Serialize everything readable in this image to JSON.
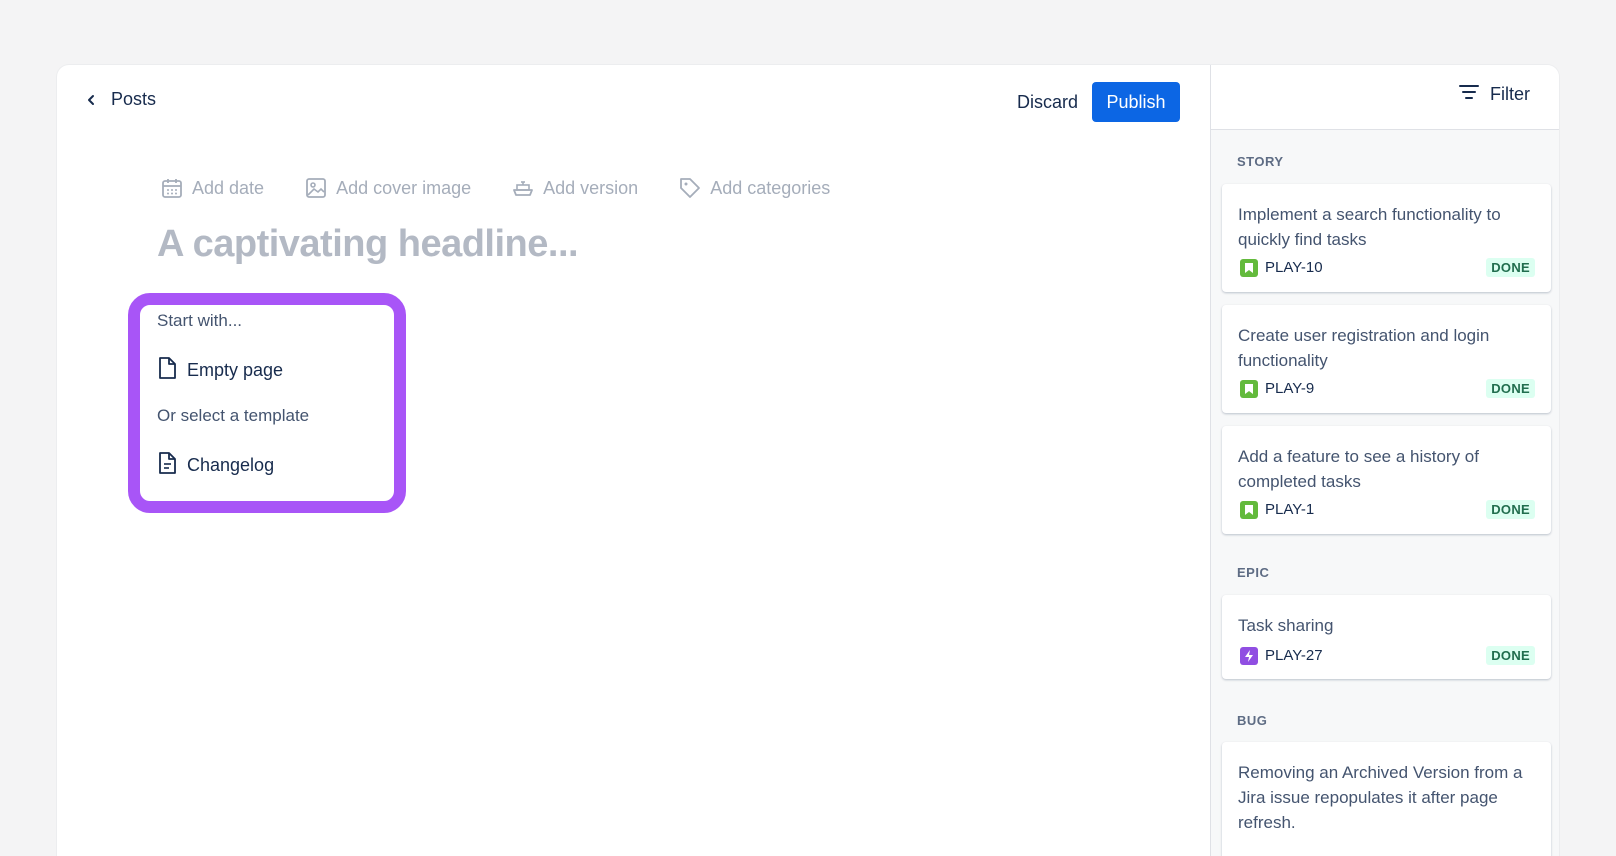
{
  "editor": {
    "back_label": "Posts",
    "discard_label": "Discard",
    "publish_label": "Publish",
    "meta": {
      "date": "Add date",
      "cover": "Add cover image",
      "version": "Add version",
      "categories": "Add categories"
    },
    "headline_placeholder": "A captivating headline...",
    "start_with_label": "Start with...",
    "empty_page_label": "Empty page",
    "template_label": "Or select a template",
    "changelog_label": "Changelog",
    "highlight_color": "#a855f7",
    "publish_color": "#0c66e4"
  },
  "sidebar": {
    "filter_label": "Filter",
    "groups": [
      {
        "title": "STORY",
        "issues": [
          {
            "title": "Implement a search functionality to quickly find tasks",
            "key": "PLAY-10",
            "status": "DONE",
            "type": "story"
          },
          {
            "title": "Create user registration and login functionality",
            "key": "PLAY-9",
            "status": "DONE",
            "type": "story"
          },
          {
            "title": "Add a feature to see a history of completed tasks",
            "key": "PLAY-1",
            "status": "DONE",
            "type": "story"
          }
        ]
      },
      {
        "title": "EPIC",
        "issues": [
          {
            "title": "Task sharing",
            "key": "PLAY-27",
            "status": "DONE",
            "type": "epic"
          }
        ]
      },
      {
        "title": "BUG",
        "issues": [
          {
            "title": "Removing an Archived Version from a Jira issue repopulates it after page refresh.",
            "type": "bug"
          }
        ]
      }
    ]
  }
}
